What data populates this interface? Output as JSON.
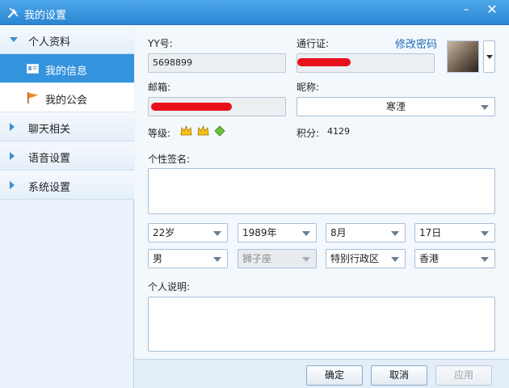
{
  "window": {
    "title": "我的设置",
    "accent": "#2e8bd6"
  },
  "sidebar": {
    "groups": [
      {
        "label": "个人资料",
        "expanded": true
      },
      {
        "label": "聊天相关",
        "expanded": false
      },
      {
        "label": "语音设置",
        "expanded": false
      },
      {
        "label": "系统设置",
        "expanded": false
      }
    ],
    "subitems": [
      {
        "label": "我的信息",
        "icon": "id-card-icon",
        "active": true
      },
      {
        "label": "我的公会",
        "icon": "flag-icon",
        "active": false
      }
    ]
  },
  "profile": {
    "yy_label": "YY号:",
    "yy_value": "5698899",
    "passport_label": "通行证:",
    "change_password": "修改密码",
    "email_label": "邮箱:",
    "nickname_label": "昵称:",
    "nickname_value": "寒湮",
    "level_label": "等级:",
    "level_icons": [
      "crown-icon",
      "crown-icon",
      "diamond-icon"
    ],
    "points_label": "积分:",
    "points_value": "4129",
    "signature_label": "个性签名:",
    "signature_value": "",
    "description_label": "个人说明:",
    "description_value": ""
  },
  "selects": {
    "age": "22岁",
    "year": "1989年",
    "month": "8月",
    "day": "17日",
    "gender": "男",
    "zodiac": "狮子座",
    "region": "特别行政区",
    "city": "香港"
  },
  "footer": {
    "ok": "确定",
    "cancel": "取消",
    "apply": "应用"
  }
}
